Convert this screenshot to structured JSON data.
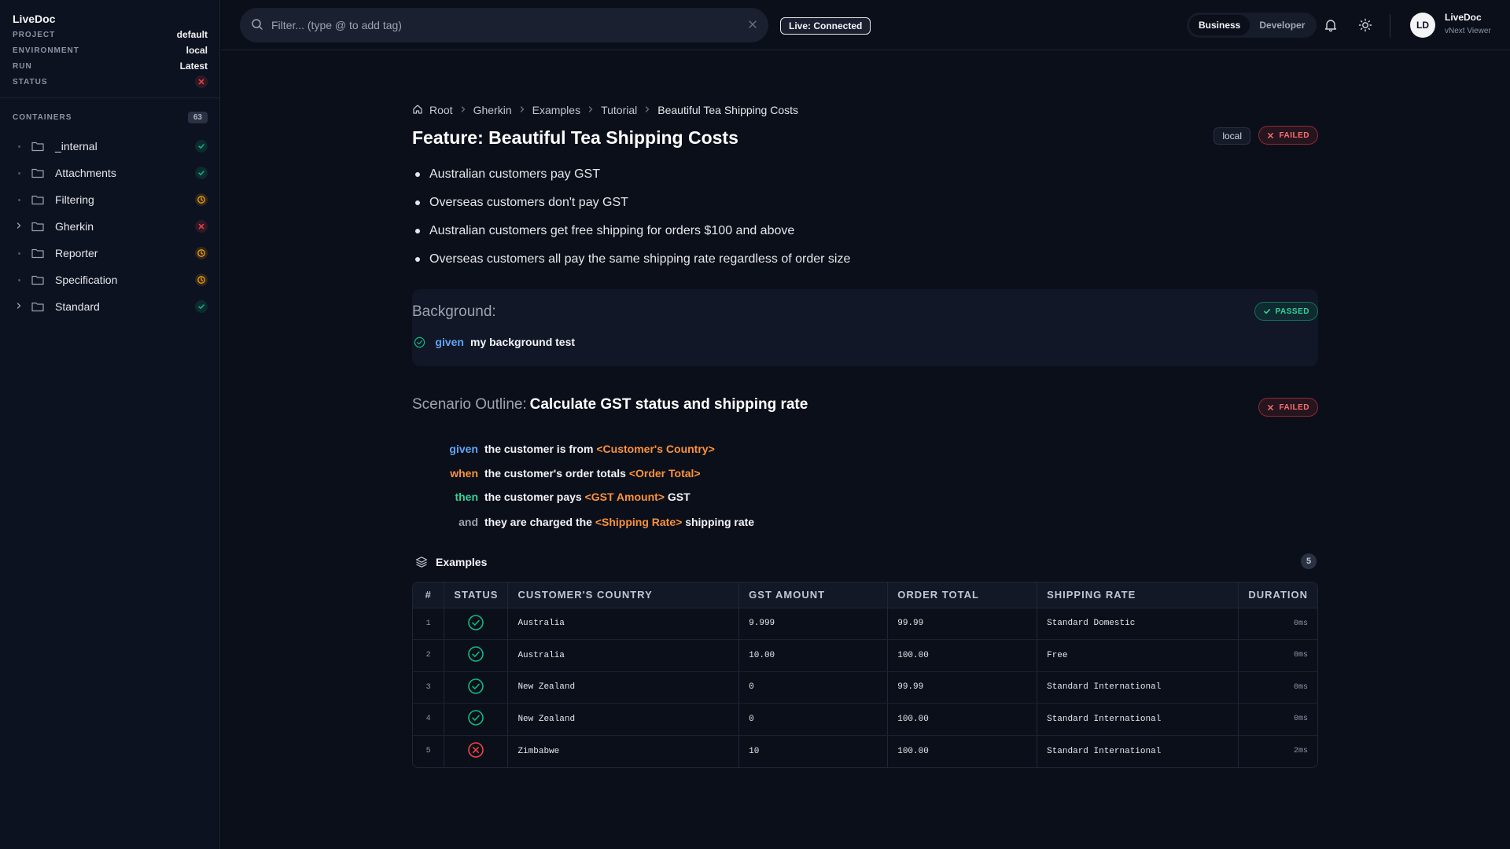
{
  "sidebar": {
    "brand": "LiveDoc",
    "meta": [
      {
        "key": "PROJECT",
        "value": "default"
      },
      {
        "key": "ENVIRONMENT",
        "value": "local"
      },
      {
        "key": "RUN",
        "value": "Latest"
      },
      {
        "key": "STATUS",
        "value": ""
      }
    ],
    "containers_label": "CONTAINERS",
    "containers_count": "63",
    "items": [
      {
        "label": "_internal",
        "status": "passed"
      },
      {
        "label": "Attachments",
        "status": "passed"
      },
      {
        "label": "Filtering",
        "status": "pending"
      },
      {
        "label": "Gherkin",
        "status": "failed"
      },
      {
        "label": "Reporter",
        "status": "pending"
      },
      {
        "label": "Specification",
        "status": "pending"
      },
      {
        "label": "Standard",
        "status": "passed"
      }
    ]
  },
  "topbar": {
    "search_placeholder": "Filter... (type @ to add tag)",
    "live_label": "Live: Connected",
    "modes": [
      "Business",
      "Developer"
    ],
    "active_mode": "Business",
    "avatar_initials": "LD",
    "user_name": "LiveDoc",
    "user_role": "vNext Viewer"
  },
  "breadcrumb": [
    "Root",
    "Gherkin",
    "Examples",
    "Tutorial",
    "Beautiful Tea Shipping Costs"
  ],
  "feature": {
    "title": "Feature: Beautiful Tea Shipping Costs",
    "env_tag": "local",
    "status_label": "FAILED",
    "rules": [
      "Australian customers pay GST",
      "Overseas customers don't pay GST",
      "Australian customers get free shipping for orders $100 and above",
      "Overseas customers all pay the same shipping rate regardless of order size"
    ]
  },
  "background": {
    "title": "Background:",
    "status_label": "PASSED",
    "step_keyword": "given",
    "step_text": "my background test"
  },
  "scenario": {
    "label": "Scenario Outline:",
    "name": "Calculate GST status and shipping rate",
    "status_label": "FAILED",
    "steps": [
      {
        "keyword": "given",
        "pre": "the customer is from",
        "param": "<Customer's Country>",
        "post": ""
      },
      {
        "keyword": "when",
        "pre": "the customer's order totals",
        "param": "<Order Total>",
        "post": ""
      },
      {
        "keyword": "then",
        "pre": "the customer pays",
        "param": "<GST Amount>",
        "post": "GST"
      },
      {
        "keyword": "and",
        "pre": "they are charged the",
        "param": "<Shipping Rate>",
        "post": "shipping rate"
      }
    ]
  },
  "examples": {
    "title": "Examples",
    "count": "5",
    "columns": [
      "#",
      "STATUS",
      "CUSTOMER'S COUNTRY",
      "GST AMOUNT",
      "ORDER TOTAL",
      "SHIPPING RATE",
      "DURATION"
    ],
    "rows": [
      {
        "n": "1",
        "status": "passed",
        "country": "Australia",
        "gst": "9.999",
        "total": "99.99",
        "rate": "Standard Domestic",
        "duration": "0ms"
      },
      {
        "n": "2",
        "status": "passed",
        "country": "Australia",
        "gst": "10.00",
        "total": "100.00",
        "rate": "Free",
        "duration": "0ms"
      },
      {
        "n": "3",
        "status": "passed",
        "country": "New Zealand",
        "gst": "0",
        "total": "99.99",
        "rate": "Standard International",
        "duration": "0ms"
      },
      {
        "n": "4",
        "status": "passed",
        "country": "New Zealand",
        "gst": "0",
        "total": "100.00",
        "rate": "Standard International",
        "duration": "0ms"
      },
      {
        "n": "5",
        "status": "failed",
        "country": "Zimbabwe",
        "gst": "10",
        "total": "100.00",
        "rate": "Standard International",
        "duration": "2ms"
      }
    ]
  },
  "colors": {
    "passed": "#10b981",
    "failed": "#ef4444",
    "pending": "#f59e0b",
    "given": "#60a5fa",
    "when": "#fb923c",
    "then": "#34d399"
  }
}
